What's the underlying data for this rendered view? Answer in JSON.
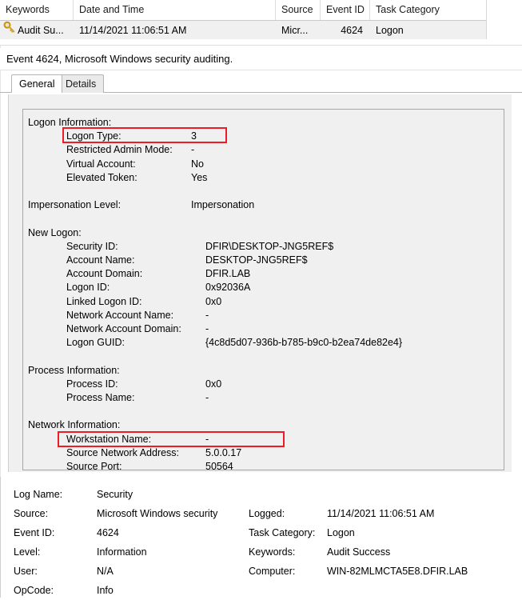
{
  "event_list": {
    "columns": [
      {
        "key": "keywords",
        "label": "Keywords"
      },
      {
        "key": "datetime",
        "label": "Date and Time"
      },
      {
        "key": "source",
        "label": "Source"
      },
      {
        "key": "event_id",
        "label": "Event ID"
      },
      {
        "key": "task_category",
        "label": "Task Category"
      }
    ],
    "row": {
      "icon": "key-icon",
      "keywords": "Audit Su...",
      "datetime": "11/14/2021 11:06:51 AM",
      "source": "Micr...",
      "event_id": "4624",
      "task_category": "Logon"
    }
  },
  "event_title": "Event 4624, Microsoft Windows security auditing.",
  "tabs": [
    {
      "label": "General",
      "active": true
    },
    {
      "label": "Details",
      "active": false
    }
  ],
  "description": {
    "logon_information": {
      "title": "Logon Information:",
      "rows": [
        {
          "label": "Logon Type:",
          "value": "3"
        },
        {
          "label": "Restricted Admin Mode:",
          "value": "-"
        },
        {
          "label": "Virtual Account:",
          "value": "No"
        },
        {
          "label": "Elevated Token:",
          "value": "Yes"
        }
      ]
    },
    "impersonation": {
      "label": "Impersonation Level:",
      "value": "Impersonation"
    },
    "new_logon": {
      "title": "New Logon:",
      "rows": [
        {
          "label": "Security ID:",
          "value": "DFIR\\DESKTOP-JNG5REF$"
        },
        {
          "label": "Account Name:",
          "value": "DESKTOP-JNG5REF$"
        },
        {
          "label": "Account Domain:",
          "value": "DFIR.LAB"
        },
        {
          "label": "Logon ID:",
          "value": "0x92036A"
        },
        {
          "label": "Linked Logon ID:",
          "value": "0x0"
        },
        {
          "label": "Network Account Name:",
          "value": "-"
        },
        {
          "label": "Network Account Domain:",
          "value": "-"
        },
        {
          "label": "Logon GUID:",
          "value": "{4c8d5d07-936b-b785-b9c0-b2ea74de82e4}"
        }
      ]
    },
    "process_information": {
      "title": "Process Information:",
      "rows": [
        {
          "label": "Process ID:",
          "value": "0x0"
        },
        {
          "label": "Process Name:",
          "value": "-"
        }
      ]
    },
    "network_information": {
      "title": "Network Information:",
      "rows": [
        {
          "label": "Workstation Name:",
          "value": "-"
        },
        {
          "label": "Source Network Address:",
          "value": "5.0.0.17"
        },
        {
          "label": "Source Port:",
          "value": "50564"
        }
      ]
    }
  },
  "annotations": {
    "color": "#ee1c25",
    "boxes": [
      {
        "name": "logon-type",
        "target": "Logon Type: 3"
      },
      {
        "name": "source-network-address",
        "target": "Source Network Address: 5.0.0.17"
      }
    ]
  },
  "metadata": {
    "left": [
      {
        "label": "Log Name:",
        "value": "Security"
      },
      {
        "label": "Source:",
        "value": "Microsoft Windows security"
      },
      {
        "label": "Event ID:",
        "value": "4624"
      },
      {
        "label": "Level:",
        "value": "Information"
      },
      {
        "label": "User:",
        "value": "N/A"
      },
      {
        "label": "OpCode:",
        "value": "Info"
      }
    ],
    "right": [
      {
        "label": "Logged:",
        "value": "11/14/2021 11:06:51 AM"
      },
      {
        "label": "Task Category:",
        "value": "Logon"
      },
      {
        "label": "Keywords:",
        "value": "Audit Success"
      },
      {
        "label": "Computer:",
        "value": "WIN-82MLMCTA5E8.DFIR.LAB"
      }
    ]
  }
}
